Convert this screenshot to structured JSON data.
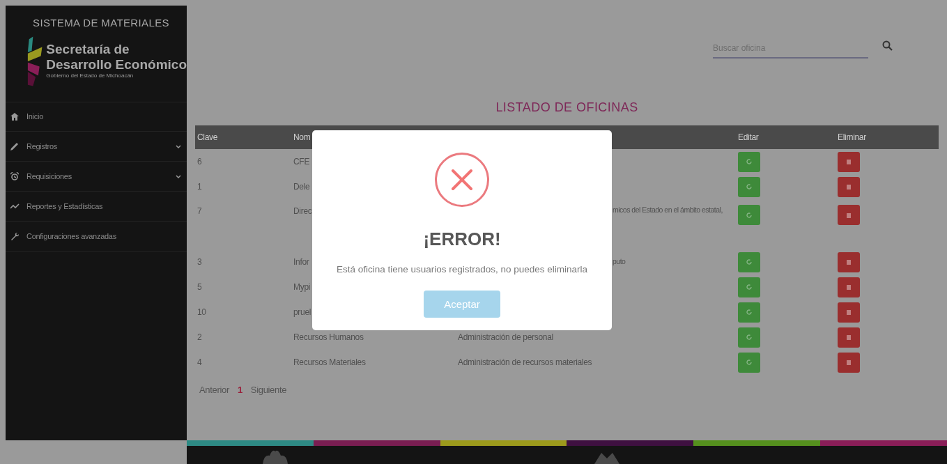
{
  "sidebar": {
    "title": "SISTEMA DE MATERIALES",
    "logo": {
      "line1": "Secretaría de",
      "line2": "Desarrollo Económico",
      "subtitle": "Gobierno del Estado de Michoacán"
    },
    "items": [
      {
        "label": "Inicio",
        "expandable": false
      },
      {
        "label": "Registros",
        "expandable": true
      },
      {
        "label": "Requisiciones",
        "expandable": true
      },
      {
        "label": "Reportes y Estadísticas",
        "expandable": false
      },
      {
        "label": "Configuraciones avanzadas",
        "expandable": false
      }
    ]
  },
  "search": {
    "placeholder": "Buscar oficina"
  },
  "page_title": "LISTADO DE OFICINAS",
  "table": {
    "columns": [
      "Clave",
      "Nom",
      "Editar",
      "Eliminar"
    ],
    "rows": [
      {
        "kind": "covered",
        "clave": "6",
        "name": "CFE",
        "description": ""
      },
      {
        "kind": "covered",
        "clave": "1",
        "name": "Dele",
        "description": ""
      },
      {
        "kind": "covered_tall",
        "clave": "7",
        "name": "Direc",
        "description": "micos del Estado en el ámbito estatal,"
      },
      {
        "kind": "covered",
        "clave": "3",
        "name": "Infor",
        "description": "puto"
      },
      {
        "kind": "covered",
        "clave": "5",
        "name": "Mypi",
        "description": ""
      },
      {
        "kind": "covered",
        "clave": "10",
        "name": "pruel",
        "description": ""
      },
      {
        "kind": "full",
        "clave": "2",
        "name": "Recursos Humanos",
        "description": "Administración de personal"
      },
      {
        "kind": "full",
        "clave": "4",
        "name": "Recursos Materiales",
        "description": "Administración de recursos materiales"
      }
    ]
  },
  "pagination": {
    "previous": "Anterior",
    "pages": [
      {
        "label": "1",
        "selected": true
      }
    ],
    "next": "Siguiente"
  },
  "dialog": {
    "title": "¡ERROR!",
    "message": "Está oficina tiene usuarios registrados, no puedes eliminarla",
    "button": "Aceptar"
  }
}
